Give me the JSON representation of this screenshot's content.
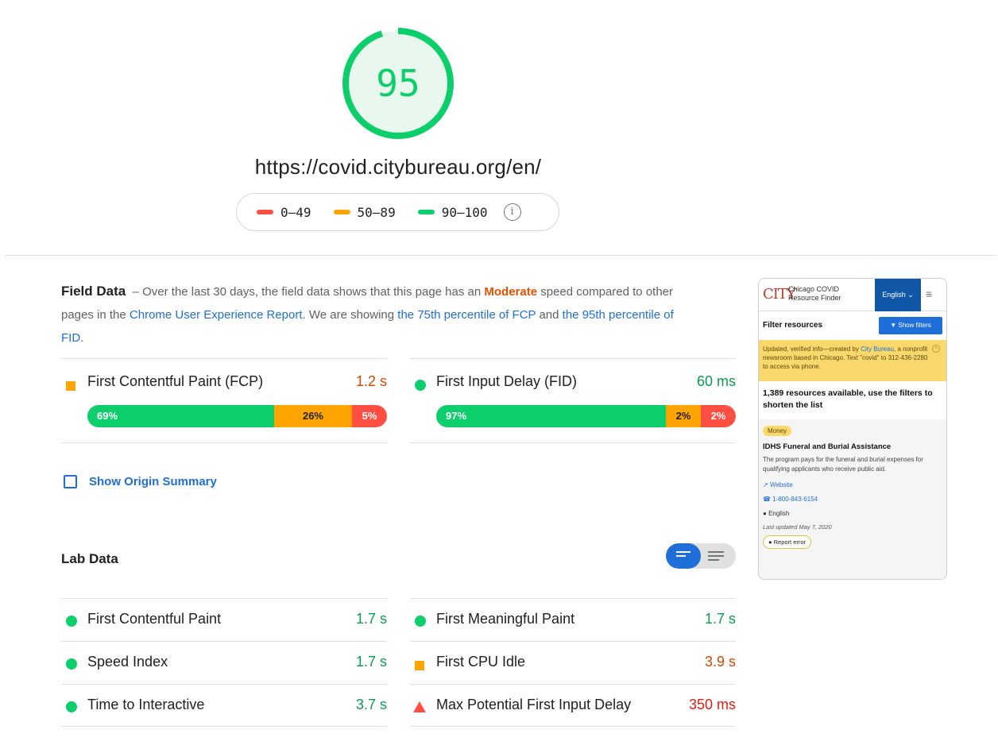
{
  "score": {
    "value": "95",
    "fraction": 0.95,
    "color": "#0cce6b"
  },
  "url": "https://covid.citybureau.org/en/",
  "legend": [
    {
      "range": "0–49",
      "color": "#ff4e42"
    },
    {
      "range": "50–89",
      "color": "#ffa400"
    },
    {
      "range": "90–100",
      "color": "#0cce6b"
    }
  ],
  "field": {
    "title": "Field Data",
    "dash": "–",
    "desc_1": "Over the last 30 days, the field data shows that this page has an",
    "moderate": "Moderate",
    "desc_2": "speed compared to other pages in the",
    "crux_link": "Chrome User Experience Report",
    "desc_3": ". We are showing",
    "fcp_link": "the 75th percentile of FCP",
    "and": "and",
    "fid_link": "the 95th percentile of FID",
    "period": ".",
    "metrics": [
      {
        "name": "First Contentful Paint (FCP)",
        "value": "1.2 s",
        "icon": "orange-square-icon",
        "dist": [
          {
            "label": "69%",
            "pct": 69
          },
          {
            "label": "26%",
            "pct": 26
          },
          {
            "label": "5%",
            "pct": 5
          }
        ]
      },
      {
        "name": "First Input Delay (FID)",
        "value": "60 ms",
        "icon": "green-circle-icon",
        "dist": [
          {
            "label": "97%",
            "pct": 97
          },
          {
            "label": "2%",
            "pct": 2
          },
          {
            "label": "2%",
            "pct": 2
          }
        ]
      }
    ]
  },
  "origin_summary": "Show Origin Summary",
  "lab": {
    "title": "Lab Data",
    "metrics": [
      {
        "name": "First Contentful Paint",
        "value": "1.7 s",
        "status": "pass"
      },
      {
        "name": "First Meaningful Paint",
        "value": "1.7 s",
        "status": "pass"
      },
      {
        "name": "Speed Index",
        "value": "1.7 s",
        "status": "pass"
      },
      {
        "name": "First CPU Idle",
        "value": "3.9 s",
        "status": "average"
      },
      {
        "name": "Time to Interactive",
        "value": "3.7 s",
        "status": "pass"
      },
      {
        "name": "Max Potential First Input Delay",
        "value": "350 ms",
        "status": "fail"
      }
    ]
  },
  "thumbnail": {
    "logo": "CITY",
    "site_line1": "Chicago COVID",
    "site_line2": "Resource Finder",
    "language": "English ⌄",
    "filter_label": "Filter resources",
    "filter_button": "Show filters",
    "notice_1": "Updated, verified info—created by",
    "notice_link": "City Bureau",
    "notice_2": ", a nonprofit newsroom based in Chicago. Text \"covid\" to 312-436-2280 to access via phone.",
    "count": "1,389 resources available, use the filters to shorten the list",
    "tag": "Money",
    "card_title": "IDHS Funeral and Burial Assistance",
    "card_desc": "The program pays for the funeral and burial expenses for qualifying applicants who receive public aid.",
    "website": "Website",
    "phone": "1-800-843-6154",
    "language_line": "English",
    "updated": "Last updated May 7, 2020",
    "report": "Report error"
  }
}
